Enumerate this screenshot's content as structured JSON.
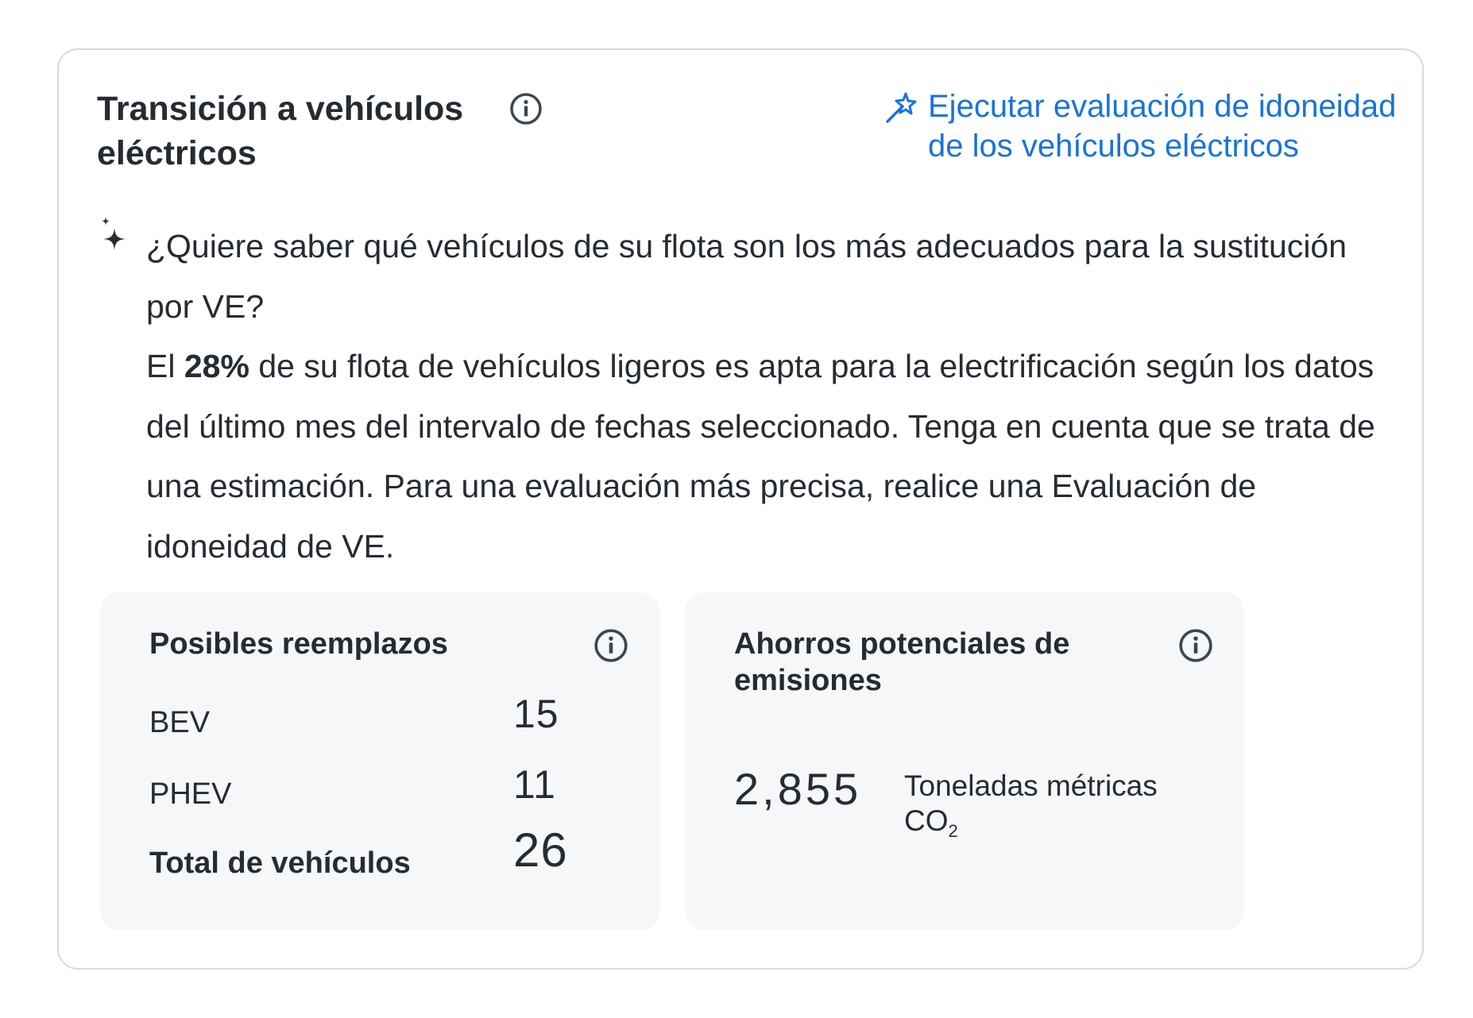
{
  "header": {
    "title": "Transición a vehículos eléctricos",
    "run_link_line1": "Ejecutar evaluación de idoneidad",
    "run_link_line2": "de los vehículos eléctricos"
  },
  "insight": {
    "question": "¿Quiere saber qué vehículos de su flota son los más adecuados para la sustitución por VE?",
    "prefix": "El",
    "percent": "28%",
    "body": "de su flota de vehículos ligeros es apta para la electrificación según los datos del último mes del intervalo de fechas seleccionado. Tenga en cuenta que se trata de una estimación. Para una evaluación más precisa, realice una Evaluación de idoneidad de VE."
  },
  "replacements": {
    "title": "Posibles reemplazos",
    "rows": [
      {
        "label": "BEV",
        "value": "15"
      },
      {
        "label": "PHEV",
        "value": "11"
      },
      {
        "label": "Total de vehículos",
        "value": "26"
      }
    ]
  },
  "emissions": {
    "title": "Ahorros potenciales de emisiones",
    "value": "2,855",
    "unit": "Toneladas métricas",
    "unit2": "CO",
    "unit2_sub": "2"
  },
  "colors": {
    "link": "#1a73d9",
    "text": "#262c33",
    "panel_bg": "#f6f7f9",
    "border": "#d7dadf"
  },
  "icons": [
    "info-icon",
    "magic-wand-icon",
    "sparkle-icon"
  ]
}
